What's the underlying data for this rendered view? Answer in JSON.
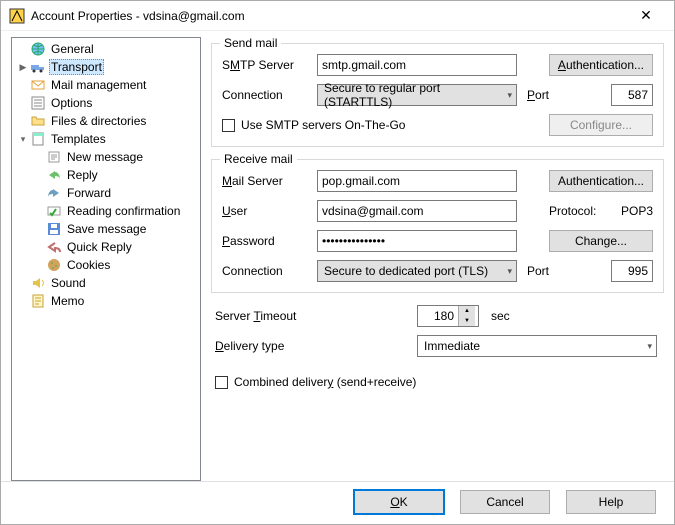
{
  "window": {
    "title": "Account Properties - vdsina@gmail.com"
  },
  "tree": {
    "items": [
      {
        "label": "General",
        "level": 1,
        "icon": "globe-icon",
        "selected": false,
        "expander": ""
      },
      {
        "label": "Transport",
        "level": 1,
        "icon": "truck-icon",
        "selected": true,
        "expander": "▶"
      },
      {
        "label": "Mail management",
        "level": 1,
        "icon": "mail-icon",
        "selected": false,
        "expander": ""
      },
      {
        "label": "Options",
        "level": 1,
        "icon": "list-icon",
        "selected": false,
        "expander": ""
      },
      {
        "label": "Files & directories",
        "level": 1,
        "icon": "folder-icon",
        "selected": false,
        "expander": ""
      },
      {
        "label": "Templates",
        "level": 1,
        "icon": "template-icon",
        "selected": false,
        "expander": "▾"
      },
      {
        "label": "New message",
        "level": 2,
        "icon": "newmsg-icon",
        "selected": false,
        "expander": ""
      },
      {
        "label": "Reply",
        "level": 2,
        "icon": "reply-icon",
        "selected": false,
        "expander": ""
      },
      {
        "label": "Forward",
        "level": 2,
        "icon": "forward-icon",
        "selected": false,
        "expander": ""
      },
      {
        "label": "Reading confirmation",
        "level": 2,
        "icon": "readconf-icon",
        "selected": false,
        "expander": ""
      },
      {
        "label": "Save message",
        "level": 2,
        "icon": "save-icon",
        "selected": false,
        "expander": ""
      },
      {
        "label": "Quick Reply",
        "level": 2,
        "icon": "quickreply-icon",
        "selected": false,
        "expander": ""
      },
      {
        "label": "Cookies",
        "level": 2,
        "icon": "cookies-icon",
        "selected": false,
        "expander": ""
      },
      {
        "label": "Sound",
        "level": 1,
        "icon": "sound-icon",
        "selected": false,
        "expander": ""
      },
      {
        "label": "Memo",
        "level": 1,
        "icon": "memo-icon",
        "selected": false,
        "expander": ""
      }
    ]
  },
  "send": {
    "legend": "Send mail",
    "smtp_label_pre": "S",
    "smtp_label_u": "M",
    "smtp_label_post": "TP Server",
    "smtp_value": "smtp.gmail.com",
    "auth_btn_u": "A",
    "auth_btn_post": "uthentication...",
    "conn_label": "Connection",
    "conn_value": "Secure to regular port (STARTTLS)",
    "port_label_u": "P",
    "port_label_post": "ort",
    "port_value": "587",
    "onthego_label": "Use SMTP servers On-The-Go",
    "configure_btn": "Configure..."
  },
  "recv": {
    "legend": "Receive mail",
    "mail_label_u": "M",
    "mail_label_post": "ail Server",
    "mail_value": "pop.gmail.com",
    "auth_btn": "Authentication...",
    "user_label_u": "U",
    "user_label_post": "ser",
    "user_value": "vdsina@gmail.com",
    "proto_label": "Protocol:",
    "proto_value": "POP3",
    "pass_label_u": "P",
    "pass_label_post": "assword",
    "pass_value": "•••••••••••••••",
    "change_btn": "Change...",
    "conn_label": "Connection",
    "conn_value": "Secure to dedicated port (TLS)",
    "port_label": "Port",
    "port_value": "995"
  },
  "timeout": {
    "label_pre": "Server ",
    "label_u": "T",
    "label_post": "imeout",
    "value": "180",
    "suffix": "sec"
  },
  "delivery": {
    "label_u": "D",
    "label_post": "elivery type",
    "value": "Immediate"
  },
  "combined": {
    "label_pre": "Combined deliver",
    "label_u": "y",
    "label_post": " (send+receive)"
  },
  "footer": {
    "ok_u": "O",
    "ok_post": "K",
    "cancel": "Cancel",
    "help": "Help"
  }
}
